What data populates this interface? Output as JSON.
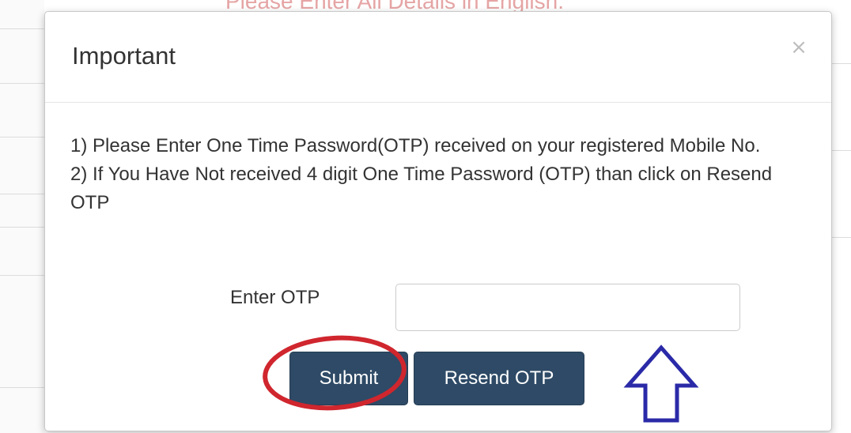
{
  "background": {
    "banner_text": "Please Enter All Details in English."
  },
  "modal": {
    "title": "Important",
    "close_symbol": "×",
    "instructions": [
      "1) Please Enter One Time Password(OTP) received on your registered Mobile No.",
      "2) If You Have Not received 4 digit One Time Password (OTP) than click on Resend OTP"
    ],
    "otp_label": "Enter OTP",
    "otp_value": "",
    "submit_label": "Submit",
    "resend_label": "Resend OTP"
  },
  "annotations": {
    "circle_color": "#d0262e",
    "arrow_color": "#2a2aa8"
  },
  "colors": {
    "button_bg": "#2e4a66",
    "banner": "#e6a5a5"
  }
}
